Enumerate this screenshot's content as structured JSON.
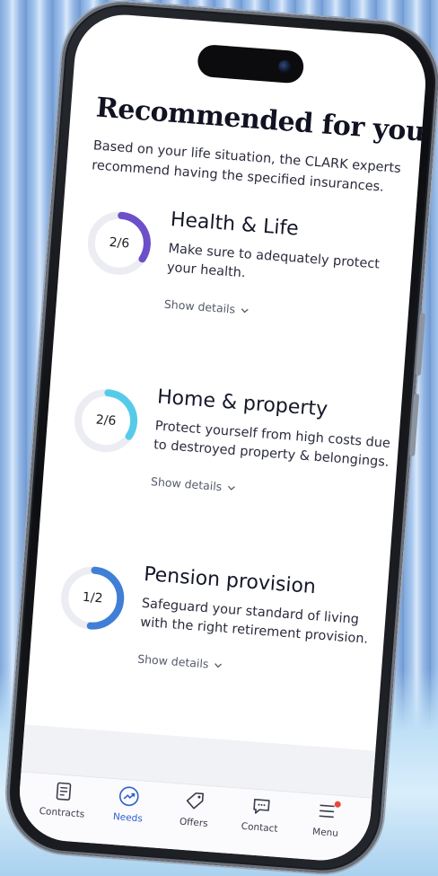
{
  "page": {
    "title": "Recommended for you",
    "subtitle": "Based on your life situation, the CLARK experts recommend having the specified insurances."
  },
  "needs": [
    {
      "ratio_label": "2/6",
      "progress": 0.333,
      "color": "#6c4fc9",
      "title": "Health & Life",
      "description": "Make sure to adequately protect your health.",
      "details_label": "Show details"
    },
    {
      "ratio_label": "2/6",
      "progress": 0.333,
      "color": "#56cbe9",
      "title": "Home & property",
      "description": "Protect yourself from high costs due to destroyed property & belongings.",
      "details_label": "Show details"
    },
    {
      "ratio_label": "1/2",
      "progress": 0.5,
      "color": "#3f7fd6",
      "title": "Pension provision",
      "description": "Safeguard your standard of living with the right retirement provision.",
      "details_label": "Show details"
    }
  ],
  "tabbar": {
    "items": [
      {
        "label": "Contracts",
        "icon": "document-icon",
        "active": false
      },
      {
        "label": "Needs",
        "icon": "trend-up-icon",
        "active": true
      },
      {
        "label": "Offers",
        "icon": "tag-icon",
        "active": false
      },
      {
        "label": "Contact",
        "icon": "chat-bubble-icon",
        "active": false
      },
      {
        "label": "Menu",
        "icon": "hamburger-menu-icon",
        "active": false,
        "badge": true
      }
    ]
  },
  "colors": {
    "accent": "#2f5fcf",
    "track": "#ececf3",
    "badge": "#e8463d"
  }
}
